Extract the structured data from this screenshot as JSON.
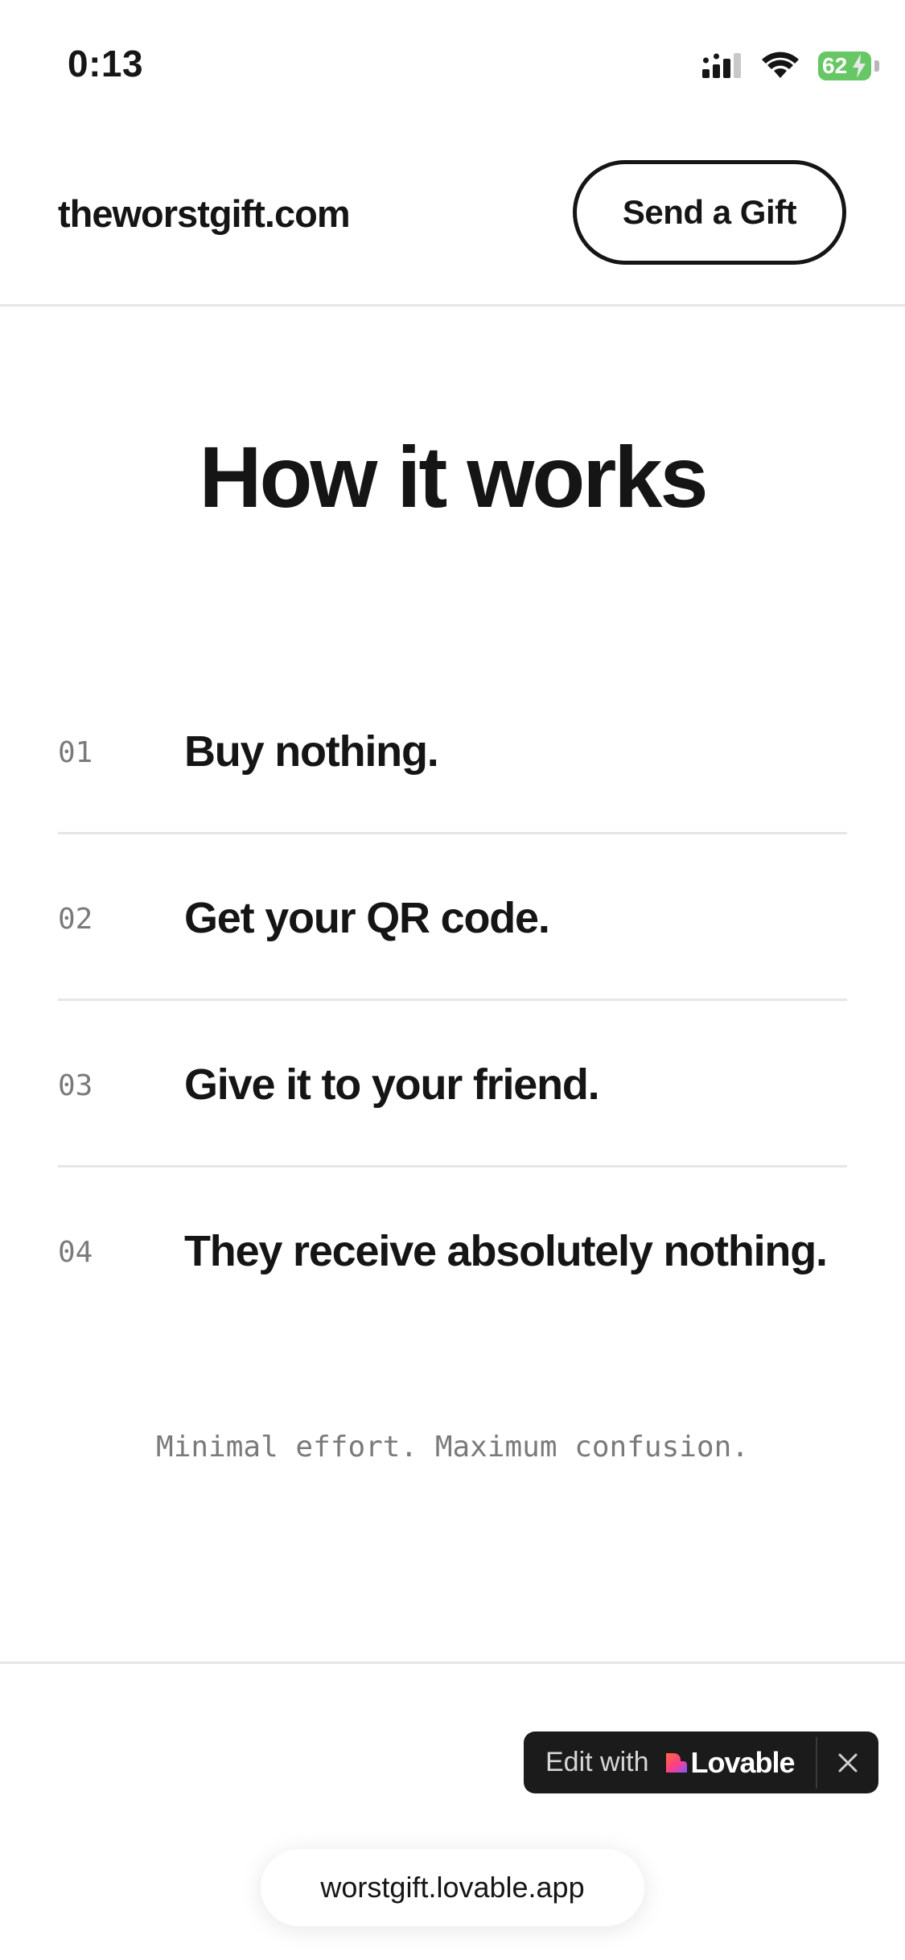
{
  "status_bar": {
    "time": "0:13",
    "battery_level": "62"
  },
  "header": {
    "logo": "theworstgift.com",
    "cta_label": "Send a Gift"
  },
  "main": {
    "heading": "How it works",
    "steps": [
      {
        "number": "01",
        "text": "Buy nothing."
      },
      {
        "number": "02",
        "text": "Get your QR code."
      },
      {
        "number": "03",
        "text": "Give it to your friend."
      },
      {
        "number": "04",
        "text": "They receive absolutely nothing."
      }
    ],
    "tagline": "Minimal effort. Maximum confusion."
  },
  "lovable_badge": {
    "edit_label": "Edit with",
    "brand": "Lovable"
  },
  "browser": {
    "url": "worstgift.lovable.app"
  },
  "colors": {
    "text": "#151515",
    "muted": "#7a7a7a",
    "divider": "#e6e6e6",
    "battery": "#66c764",
    "badge_bg": "#1b1b1b"
  }
}
